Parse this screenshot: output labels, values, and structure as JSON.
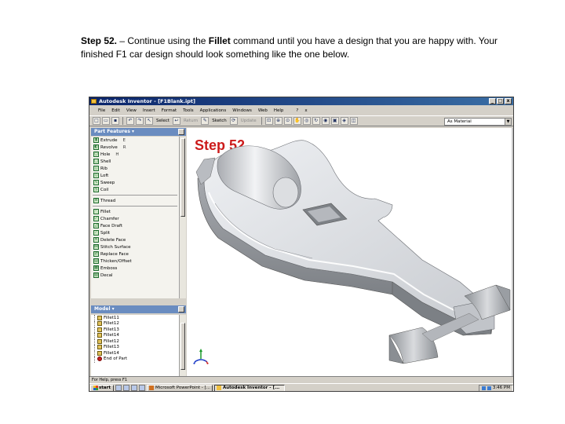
{
  "instructions": {
    "step_heading": "Step 52.",
    "text_before_bold": " – Continue using the ",
    "bold_term": "Fillet",
    "text_after_bold": " command until you have a design that you are happy with. Your finished F1 car design should look something like the one below."
  },
  "window": {
    "title": "Autodesk Inventor - [F1Blank.ipt]",
    "controls": [
      "_",
      "□",
      "x"
    ]
  },
  "menubar": {
    "items": [
      "File",
      "Edit",
      "View",
      "Insert",
      "Format",
      "Tools",
      "Applications",
      "Windows",
      "Web",
      "Help"
    ],
    "help_icon": "?",
    "close_icon": "x"
  },
  "toolbar": {
    "select_label": "Select",
    "return_label": "Return",
    "sketch_label": "Sketch",
    "update_label": "Update",
    "material_value": "As Material"
  },
  "part_features": {
    "header": "Part Features",
    "items": [
      {
        "label": "Extrude",
        "shortcut": "E"
      },
      {
        "label": "Revolve",
        "shortcut": "R"
      },
      {
        "label": "Hole",
        "shortcut": "H"
      },
      {
        "label": "Shell",
        "shortcut": ""
      },
      {
        "label": "Rib",
        "shortcut": ""
      },
      {
        "label": "Loft",
        "shortcut": ""
      },
      {
        "label": "Sweep",
        "shortcut": ""
      },
      {
        "label": "Coil",
        "shortcut": ""
      },
      {
        "label": "Thread",
        "shortcut": ""
      },
      {
        "label": "Fillet",
        "shortcut": ""
      },
      {
        "label": "Chamfer",
        "shortcut": ""
      },
      {
        "label": "Face Draft",
        "shortcut": ""
      },
      {
        "label": "Split",
        "shortcut": ""
      },
      {
        "label": "Delete Face",
        "shortcut": ""
      },
      {
        "label": "Stitch Surface",
        "shortcut": ""
      },
      {
        "label": "Replace Face",
        "shortcut": ""
      },
      {
        "label": "Thicken/Offset",
        "shortcut": ""
      },
      {
        "label": "Emboss",
        "shortcut": ""
      },
      {
        "label": "Decal",
        "shortcut": ""
      }
    ]
  },
  "model_browser": {
    "header": "Model",
    "items": [
      "Fillet11",
      "Fillet12",
      "Fillet13",
      "Fillet14",
      "Fillet12",
      "Fillet13",
      "Fillet14",
      "End of Part"
    ]
  },
  "viewport": {
    "step_label": "Step 52",
    "accent_color": "#cc1b1b"
  },
  "status": {
    "text": "For Help, press F1"
  },
  "taskbar": {
    "start_label": "start",
    "tasks": [
      {
        "label": "Microsoft PowerPoint - [...",
        "active": false
      },
      {
        "label": "Autodesk Inventor - [...",
        "active": true
      }
    ],
    "clock": "3:46 PM"
  }
}
